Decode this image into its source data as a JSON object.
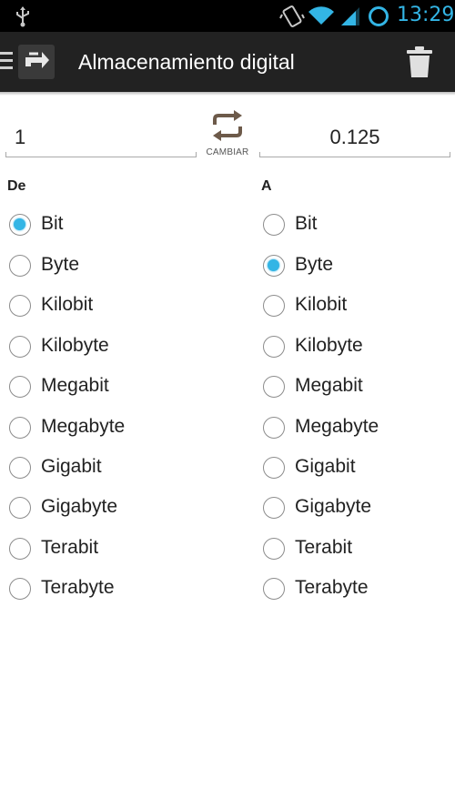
{
  "status_bar": {
    "time": "13:29",
    "accent": "#33b5e5",
    "icons": [
      "usb-icon",
      "vibrate-icon",
      "wifi-icon",
      "signal-icon",
      "alarm-icon"
    ]
  },
  "action_bar": {
    "title": "Almacenamiento digital",
    "background": "#222222",
    "icons": [
      "menu-icon",
      "app-icon",
      "trash-icon"
    ]
  },
  "converter": {
    "from_value": "1",
    "to_value": "0.125",
    "swap_label": "CAMBIAR"
  },
  "from_column": {
    "heading": "De",
    "selected": "Bit",
    "options": [
      "Bit",
      "Byte",
      "Kilobit",
      "Kilobyte",
      "Megabit",
      "Megabyte",
      "Gigabit",
      "Gigabyte",
      "Terabit",
      "Terabyte"
    ]
  },
  "to_column": {
    "heading": "A",
    "selected": "Byte",
    "options": [
      "Bit",
      "Byte",
      "Kilobit",
      "Kilobyte",
      "Megabit",
      "Megabyte",
      "Gigabit",
      "Gigabyte",
      "Terabit",
      "Terabyte"
    ]
  }
}
